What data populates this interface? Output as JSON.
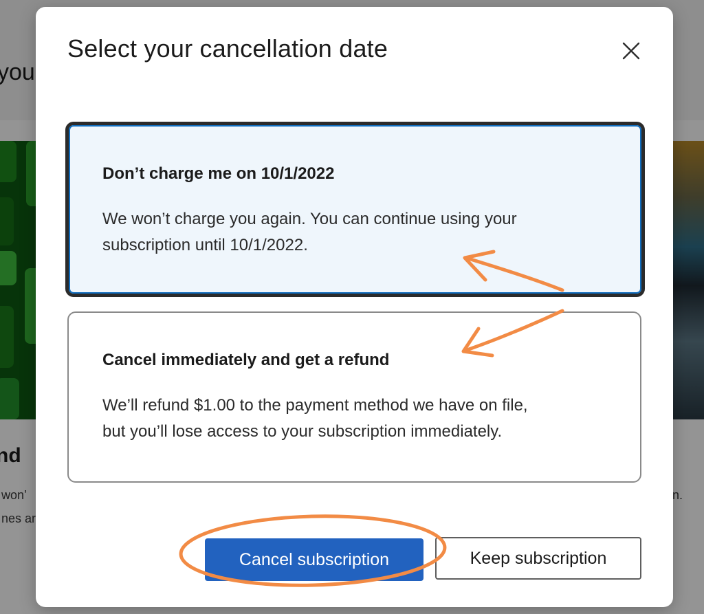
{
  "background": {
    "heading_fragment": "you",
    "card_title_fragment": "nd",
    "card_text_line1": "won’",
    "card_text_line2": "nes ar",
    "right_text_fragment": "n."
  },
  "dialog": {
    "title": "Select your cancellation date",
    "close_icon": "close-icon",
    "options": [
      {
        "title": "Don’t charge me on 10/1/2022",
        "description_line1": "We won’t charge you again. You can continue using your",
        "description_line2": "subscription until 10/1/2022.",
        "selected": true
      },
      {
        "title": "Cancel immediately and get a refund",
        "description_line1": "We’ll refund $1.00 to the payment method we have on file,",
        "description_line2": "but you’ll lose access to your subscription immediately.",
        "selected": false
      }
    ],
    "buttons": {
      "primary_label": "Cancel subscription",
      "secondary_label": "Keep subscription"
    }
  },
  "colors": {
    "primary_button": "#2262bf",
    "selected_option_bg": "#eff6fc",
    "annotation": "#f28b45"
  }
}
